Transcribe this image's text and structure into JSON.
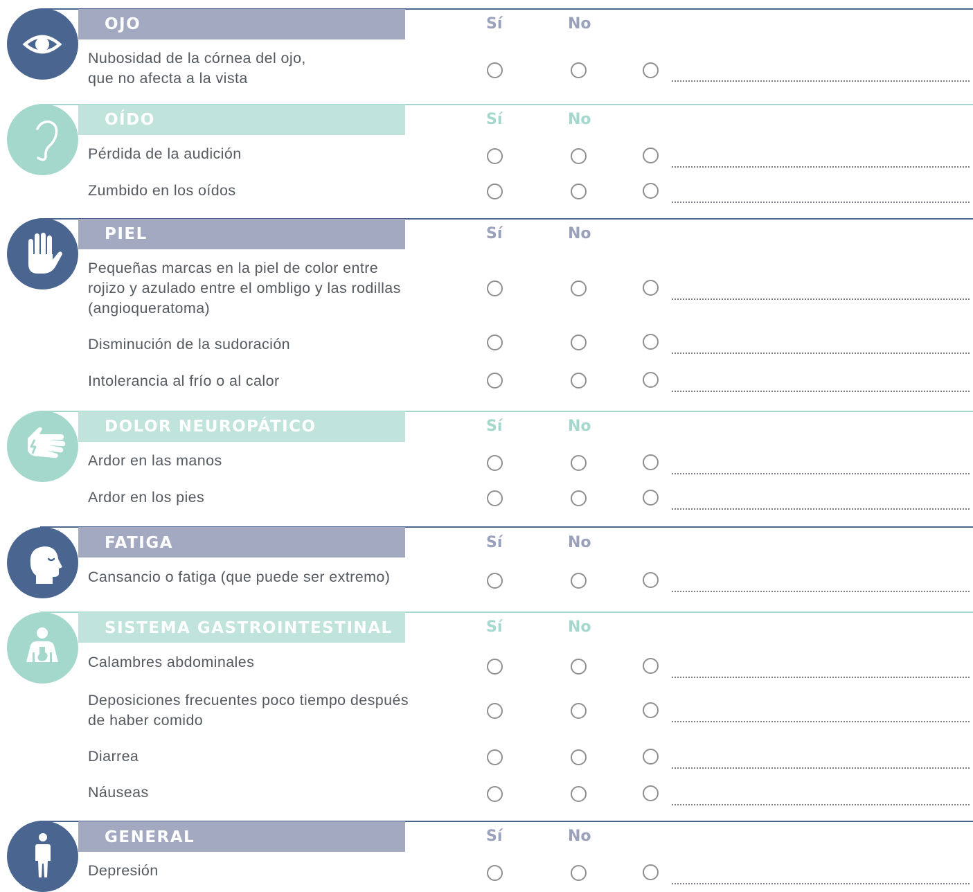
{
  "sections": [
    {
      "title": "OJO",
      "icon": "eye-icon",
      "yes": "Sí",
      "no": "No",
      "items": [
        "Nubosidad de la córnea del ojo,\nque no afecta a la vista"
      ]
    },
    {
      "title": "OÍDO",
      "icon": "ear-icon",
      "yes": "Sí",
      "no": "No",
      "items": [
        "Pérdida de la audición",
        "Zumbido en los oídos"
      ]
    },
    {
      "title": "PIEL",
      "icon": "hand-icon",
      "yes": "Sí",
      "no": "No",
      "items": [
        "Pequeñas marcas en la piel de color entre\nrojizo y azulado entre el ombligo y las rodillas\n(angioqueratoma)",
        "Disminución de la sudoración",
        "Intolerancia al frío o al calor"
      ]
    },
    {
      "title": "DOLOR NEUROPÁTICO",
      "icon": "burning-hand-icon",
      "yes": "Sí",
      "no": "No",
      "items": [
        "Ardor en las manos",
        "Ardor en los pies"
      ]
    },
    {
      "title": "FATIGA",
      "icon": "tired-head-icon",
      "yes": "Sí",
      "no": "No",
      "items": [
        "Cansancio o fatiga (que puede ser extremo)"
      ]
    },
    {
      "title": "SISTEMA GASTROINTESTINAL",
      "icon": "torso-stomach-icon",
      "yes": "Sí",
      "no": "No",
      "items": [
        "Calambres abdominales",
        "Deposiciones frecuentes poco tiempo después\nde haber comido",
        "Diarrea",
        "Náuseas"
      ]
    },
    {
      "title": "GENERAL",
      "icon": "person-icon",
      "yes": "Sí",
      "no": "No",
      "items": [
        "Depresión"
      ]
    }
  ],
  "colors": {
    "navy": "#4a6690",
    "navy_bar": "#a3a9c0",
    "mint": "#a5d8cd",
    "mint_bar": "#c0e3db",
    "text": "#555a60",
    "radio": "#8f8f8f"
  }
}
